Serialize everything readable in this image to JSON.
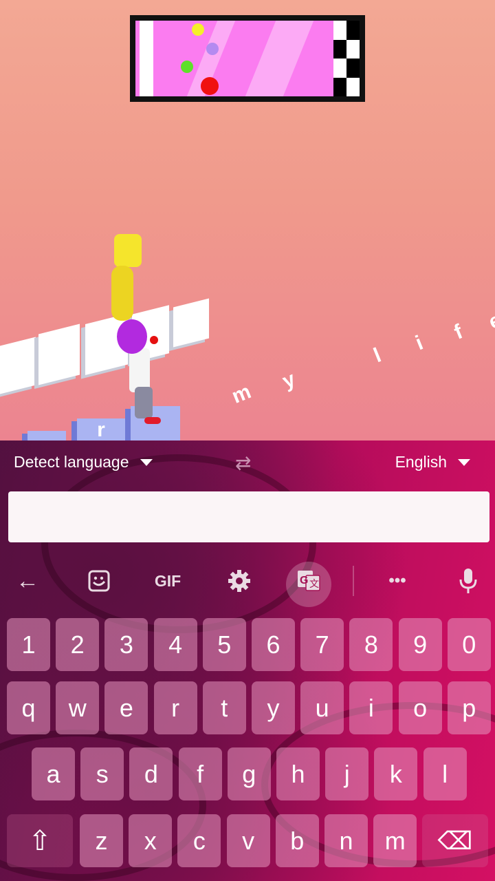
{
  "game": {
    "progress_bar": {
      "colors": {
        "track": "#fb7cf0",
        "stripe": "#fcaaf5",
        "frame": "#111111"
      },
      "players": [
        {
          "name": "yellow",
          "color": "#f5ef2a"
        },
        {
          "name": "purple",
          "color": "#b48af0"
        },
        {
          "name": "green",
          "color": "#5ee028"
        },
        {
          "name": "red",
          "color": "#f01010"
        }
      ]
    },
    "floor_word_letters": [
      "m",
      "y",
      "l",
      "i",
      "f",
      "e"
    ],
    "block_letter": "r"
  },
  "translate_bar": {
    "source_language": "Detect language",
    "target_language": "English",
    "input_value": "",
    "input_placeholder": ""
  },
  "toolbar": {
    "back_icon": "←",
    "gif_label": "GIF",
    "more_icon": "•••"
  },
  "keyboard": {
    "rows": [
      [
        "1",
        "2",
        "3",
        "4",
        "5",
        "6",
        "7",
        "8",
        "9",
        "0"
      ],
      [
        "q",
        "w",
        "e",
        "r",
        "t",
        "y",
        "u",
        "i",
        "o",
        "p"
      ],
      [
        "a",
        "s",
        "d",
        "f",
        "g",
        "h",
        "j",
        "k",
        "l"
      ],
      [
        "z",
        "x",
        "c",
        "v",
        "b",
        "n",
        "m"
      ]
    ],
    "shift_icon": "⇧",
    "backspace_icon": "⌫"
  }
}
